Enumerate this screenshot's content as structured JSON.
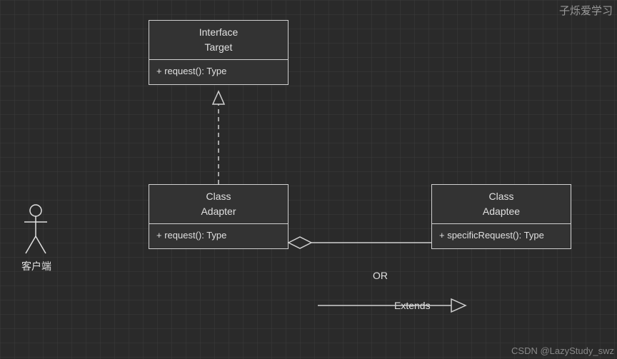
{
  "watermark_top": "子烁爱学习",
  "watermark_bottom": "CSDN @LazyStudy_swz",
  "actor": {
    "label": "客户端"
  },
  "boxes": {
    "target": {
      "stereotype": "Interface",
      "name": "Target",
      "method": "+ request(): Type"
    },
    "adapter": {
      "stereotype": "Class",
      "name": "Adapter",
      "method": "+ request(): Type"
    },
    "adaptee": {
      "stereotype": "Class",
      "name": "Adaptee",
      "method": "+ specificRequest(): Type"
    }
  },
  "labels": {
    "or": "OR",
    "extends": "Extends"
  }
}
